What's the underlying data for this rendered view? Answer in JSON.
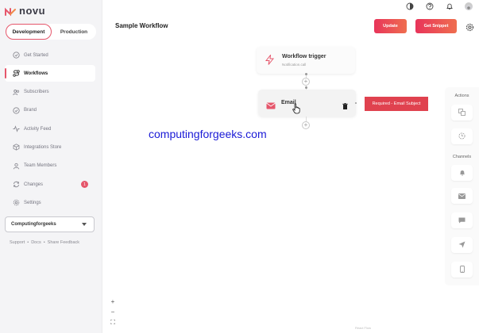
{
  "app": {
    "name": "novu",
    "accent": "#e5566b"
  },
  "env_toggle": {
    "development": "Development",
    "production": "Production"
  },
  "nav": {
    "items": [
      {
        "label": "Get Started",
        "icon": "checklist-icon"
      },
      {
        "label": "Workflows",
        "icon": "route-icon"
      },
      {
        "label": "Subscribers",
        "icon": "users-icon"
      },
      {
        "label": "Brand",
        "icon": "brand-check-icon"
      },
      {
        "label": "Activity Feed",
        "icon": "activity-icon"
      },
      {
        "label": "Integrations Store",
        "icon": "box-icon"
      },
      {
        "label": "Team Members",
        "icon": "team-icon"
      },
      {
        "label": "Changes",
        "icon": "sync-icon",
        "badge": "1"
      },
      {
        "label": "Settings",
        "icon": "gear-icon"
      }
    ]
  },
  "org": {
    "name": "Computingforgeeks"
  },
  "footer": {
    "support": "Support",
    "sep1": "•",
    "docs": "Docs",
    "sep2": "•",
    "feedback": "Share Feedback"
  },
  "header": {
    "title": "Sample Workflow",
    "update_label": "Update",
    "snippet_label": "Get Snippet"
  },
  "canvas": {
    "trigger": {
      "title": "Workflow trigger",
      "subtitle": "Notification.call"
    },
    "email": {
      "title": "Email"
    },
    "error": "Required - Email Subject",
    "watermark": "computingforgeeks.com",
    "zoom_in": "+",
    "zoom_out": "−",
    "fit": "⛶",
    "plus": "+",
    "attribution": "React Flow"
  },
  "right_panel": {
    "actions_label": "Actions",
    "channels_label": "Channels"
  }
}
